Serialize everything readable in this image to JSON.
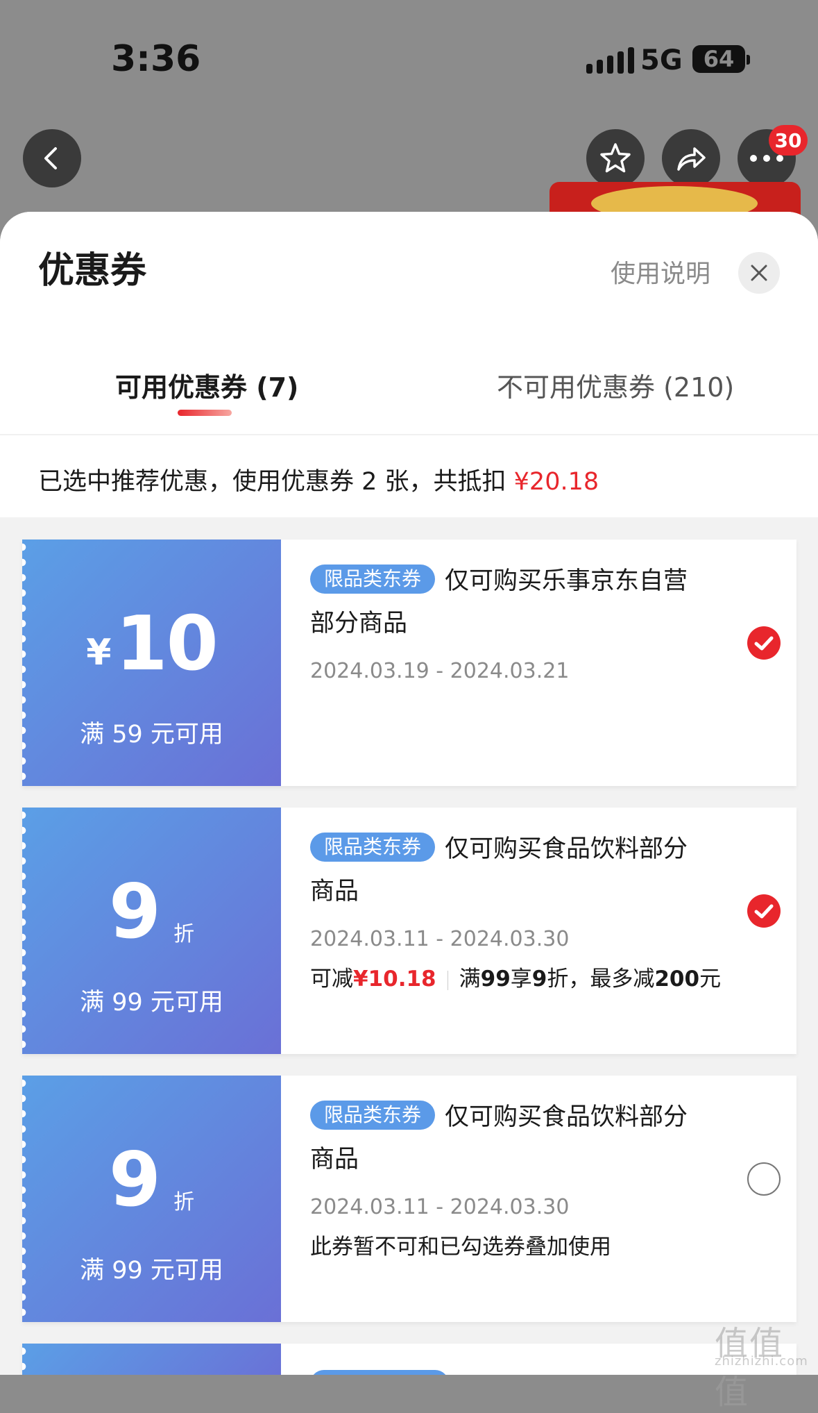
{
  "status_bar": {
    "time": "3:36",
    "network": "5G",
    "battery": "64"
  },
  "nav": {
    "badge_count": "30"
  },
  "sheet": {
    "title": "优惠券",
    "usage_link": "使用说明",
    "tabs": [
      {
        "label": "可用优惠券 (7)",
        "active": true
      },
      {
        "label": "不可用优惠券 (210)",
        "active": false
      }
    ],
    "summary_prefix": "已选中推荐优惠，使用优惠券 2 张，共抵扣 ",
    "summary_amount": "¥20.18"
  },
  "coupons": [
    {
      "currency": "¥",
      "value": "10",
      "unit": "",
      "condition": "满 59 元可用",
      "tag": "限品类东券",
      "desc_line1": "仅可购买乐事京东自营",
      "desc_line2": "部分商品",
      "dates": "2024.03.19 - 2024.03.21",
      "selected": true
    },
    {
      "currency": "",
      "value": "9",
      "unit": "折",
      "condition": "满 99 元可用",
      "tag": "限品类东券",
      "desc_line1": "仅可购买食品饮料部分",
      "desc_line2": "商品",
      "dates": "2024.03.11 - 2024.03.30",
      "save_label": "可减",
      "save_amount": "¥10.18",
      "rule_prefix": "满",
      "rule_threshold": "99",
      "rule_mid": "享",
      "rule_discount": "9",
      "rule_after": "折，最多减",
      "rule_cap": "200",
      "rule_suffix": "元",
      "selected": true
    },
    {
      "currency": "",
      "value": "9",
      "unit": "折",
      "condition": "满 99 元可用",
      "tag": "限品类东券",
      "desc_line1": "仅可购买食品饮料部分",
      "desc_line2": "商品",
      "dates": "2024.03.11 - 2024.03.30",
      "note": "此券暂不可和已勾选券叠加使用",
      "selected": false
    }
  ],
  "watermark": {
    "text": "值值值",
    "sub": "zhizhizhi.com"
  },
  "colors": {
    "accent": "#e8262c",
    "coupon_start": "#5b9fe6",
    "coupon_end": "#6a70d6",
    "tag": "#5b9ae8"
  }
}
